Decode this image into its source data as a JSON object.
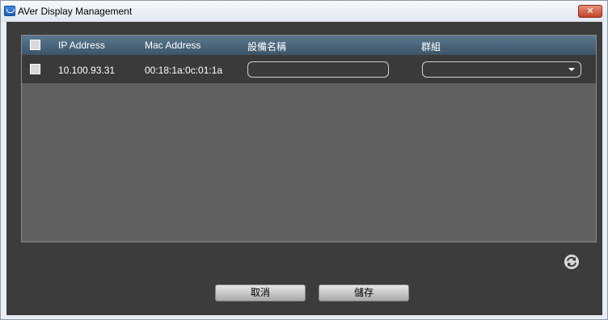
{
  "window": {
    "title": "AVer Display Management",
    "close_glyph": "✕"
  },
  "table": {
    "headers": {
      "ip": "IP Address",
      "mac": "Mac Address",
      "device_name": "設備名稱",
      "group": "群組"
    },
    "rows": [
      {
        "checked": false,
        "ip": "10.100.93.31",
        "mac": "00:18:1a:0c:01:1a",
        "device_name": "",
        "group": ""
      }
    ]
  },
  "icons": {
    "app": "aver-app-icon",
    "refresh": "refresh-icon",
    "dropdown": "chevron-down-icon"
  },
  "buttons": {
    "cancel": "取消",
    "save": "儲存"
  },
  "colors": {
    "client_bg": "#3c3c3c",
    "table_bg": "#616161",
    "header_bg": "#4a6679",
    "close_red": "#c2432b"
  }
}
